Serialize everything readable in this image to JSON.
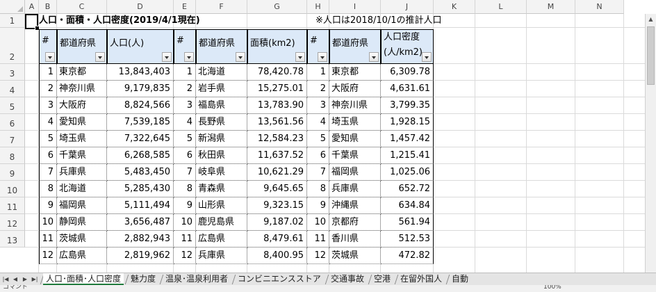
{
  "column_headers": [
    "A",
    "B",
    "C",
    "D",
    "E",
    "F",
    "G",
    "H",
    "I",
    "J",
    "K",
    "L",
    "M",
    "N"
  ],
  "row_headers": [
    "1",
    "2",
    "3",
    "4",
    "5",
    "6",
    "7",
    "8",
    "9",
    "10",
    "11",
    "12",
    "13"
  ],
  "sheet": {
    "title": "人口・面積・人口密度(2019/4/1現在)",
    "note": "※人口は2018/10/1の推計人口",
    "headers": [
      "#",
      "都道府県",
      "人口(人)",
      "#",
      "都道府県",
      "面積(km2)",
      "#",
      "都道府県",
      "人口密度",
      "(人/km2)"
    ],
    "rows": [
      [
        "1",
        "東京都",
        "13,843,403",
        "1",
        "北海道",
        "78,420.78",
        "1",
        "東京都",
        "6,309.78"
      ],
      [
        "2",
        "神奈川県",
        "9,179,835",
        "2",
        "岩手県",
        "15,275.01",
        "2",
        "大阪府",
        "4,631.61"
      ],
      [
        "3",
        "大阪府",
        "8,824,566",
        "3",
        "福島県",
        "13,783.90",
        "3",
        "神奈川県",
        "3,799.35"
      ],
      [
        "4",
        "愛知県",
        "7,539,185",
        "4",
        "長野県",
        "13,561.56",
        "4",
        "埼玉県",
        "1,928.15"
      ],
      [
        "5",
        "埼玉県",
        "7,322,645",
        "5",
        "新潟県",
        "12,584.23",
        "5",
        "愛知県",
        "1,457.42"
      ],
      [
        "6",
        "千葉県",
        "6,268,585",
        "6",
        "秋田県",
        "11,637.52",
        "6",
        "千葉県",
        "1,215.41"
      ],
      [
        "7",
        "兵庫県",
        "5,483,450",
        "7",
        "岐阜県",
        "10,621.29",
        "7",
        "福岡県",
        "1,025.06"
      ],
      [
        "8",
        "北海道",
        "5,285,430",
        "8",
        "青森県",
        "9,645.65",
        "8",
        "兵庫県",
        "652.72"
      ],
      [
        "9",
        "福岡県",
        "5,111,494",
        "9",
        "山形県",
        "9,323.15",
        "9",
        "沖縄県",
        "634.84"
      ],
      [
        "10",
        "静岡県",
        "3,656,487",
        "10",
        "鹿児島県",
        "9,187.02",
        "10",
        "京都府",
        "561.94"
      ],
      [
        "11",
        "茨城県",
        "2,882,943",
        "11",
        "広島県",
        "8,479.61",
        "11",
        "香川県",
        "512.53"
      ],
      [
        "12",
        "広島県",
        "2,819,962",
        "12",
        "兵庫県",
        "8,400.95",
        "12",
        "茨城県",
        "472.82"
      ]
    ]
  },
  "tabs": [
    {
      "label": "人口･面積･人口密度",
      "active": true
    },
    {
      "label": "魅力度",
      "active": false
    },
    {
      "label": "温泉･温泉利用者",
      "active": false
    },
    {
      "label": "コンビニエンスストア",
      "active": false
    },
    {
      "label": "交通事故",
      "active": false
    },
    {
      "label": "空港",
      "active": false
    },
    {
      "label": "在留外国人",
      "active": false
    },
    {
      "label": "自動",
      "active": false
    }
  ],
  "status": {
    "mode": "コマンド",
    "zoom": "100%"
  }
}
